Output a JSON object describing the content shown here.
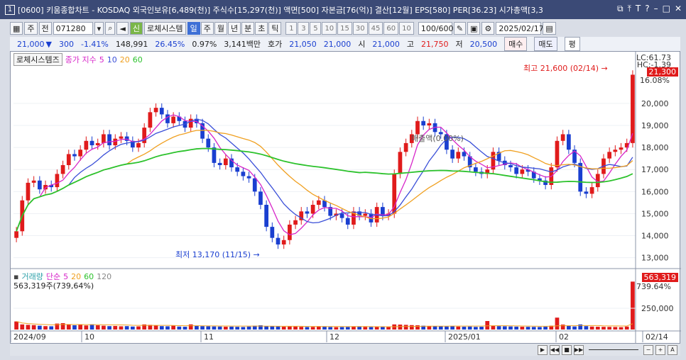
{
  "window": {
    "badge": "1",
    "title": "[0600] 키움종합차트 - KOSDAQ 외국인보유[6,489(천)] 주식수[15,297(천)] 액면[500] 자본금[76(억)] 결산[12월] EPS[580] PER[36.23] 시가총액[3,3"
  },
  "toolbar": {
    "period_type": "주",
    "prev_label": "전",
    "code": "071280",
    "indicator_btn": "로체시스템",
    "tabs": [
      "일",
      "주",
      "월",
      "년",
      "분",
      "초",
      "틱"
    ],
    "active_tab": "일",
    "intervals": [
      "1",
      "3",
      "5",
      "10",
      "15",
      "30",
      "45",
      "60",
      "10"
    ],
    "count": "100/600",
    "date": "2025/02/17"
  },
  "quote": {
    "price": "21,000",
    "arrow": "▼",
    "change": "300",
    "change_pct": "-1.41%",
    "volume": "148,991",
    "ratio": "26.45%",
    "turnover": "0.97%",
    "amount": "3,141백만",
    "bid_label": "호가",
    "bid1": "21,050",
    "bid2": "21,000",
    "open_label": "시",
    "open": "21,000",
    "high_label": "고",
    "high": "21,750",
    "low_label": "저",
    "low": "20,500",
    "buy_label": "매수",
    "sell_label": "매도",
    "eval_label": "평"
  },
  "legend": {
    "stock_name": "로체시스템즈",
    "ma_label": "종가 지수",
    "ma_periods": [
      "5",
      "10",
      "20",
      "60"
    ],
    "ma_colors": [
      "#d726c9",
      "#3a4fd8",
      "#f0a020",
      "#2cc22c"
    ]
  },
  "volume_legend": {
    "label": "거래량",
    "ma_label": "단순",
    "ma_periods": [
      "5",
      "20",
      "60",
      "120"
    ],
    "value_text": "563,319주(739,64%)"
  },
  "annotations": {
    "high": "최고 21,600 (02/14) →",
    "low": "최저 13,170 (11/15) →",
    "overlay": "매출액(0.00%)"
  },
  "price_tags": {
    "lc": "LC:61.73",
    "hc": "HC:-1.39",
    "current": "21,300",
    "pct": "16.08%",
    "vol_current": "563,319",
    "vol_pct": "739.64%"
  },
  "chart_data": {
    "type": "candlestick",
    "price_axis_ticks": [
      "20,000",
      "19,000",
      "18,000",
      "17,000",
      "16,000",
      "15,000",
      "14,000",
      "13,000"
    ],
    "ylim": [
      12700,
      21700
    ],
    "volume_axis_ticks": [
      "250,000"
    ],
    "x_ticks": [
      "2024/09",
      "10",
      "11",
      "12",
      "2025/01",
      "02",
      "02/14"
    ],
    "closes": [
      14200,
      15600,
      16400,
      16500,
      16100,
      16300,
      16200,
      16800,
      17200,
      17700,
      17600,
      17900,
      18300,
      18100,
      18200,
      18600,
      18100,
      18400,
      18500,
      18300,
      18000,
      18200,
      18900,
      19600,
      19800,
      19500,
      19100,
      19400,
      19200,
      18900,
      19300,
      19100,
      18400,
      18000,
      17300,
      17200,
      17500,
      17100,
      16900,
      16700,
      16600,
      16000,
      15400,
      14400,
      13900,
      13600,
      13800,
      14500,
      14700,
      15100,
      15000,
      15400,
      15600,
      15300,
      14900,
      15000,
      14800,
      14500,
      15100,
      14900,
      15000,
      14600,
      15300,
      14900,
      15000,
      16800,
      17800,
      18200,
      18600,
      19200,
      19000,
      19100,
      18700,
      18600,
      17900,
      17500,
      17800,
      17600,
      17100,
      16900,
      16800,
      17000,
      17800,
      17400,
      17200,
      17100,
      16800,
      17000,
      16900,
      16600,
      16500,
      16300,
      17100,
      18300,
      18600,
      17900,
      17300,
      16000,
      15900,
      16200,
      16800,
      17500,
      17800,
      17900,
      18000,
      18200,
      21300
    ],
    "volumes": [
      95000,
      60000,
      55000,
      52000,
      45000,
      40000,
      38000,
      70000,
      75000,
      60000,
      50000,
      55000,
      48000,
      62000,
      50000,
      45000,
      40000,
      42000,
      38000,
      40000,
      35000,
      37000,
      60000,
      55000,
      48000,
      40000,
      38000,
      45000,
      35000,
      33000,
      60000,
      42000,
      40000,
      38000,
      36000,
      35000,
      33000,
      34000,
      32000,
      30000,
      35000,
      45000,
      50000,
      42000,
      40000,
      38000,
      33000,
      36000,
      35000,
      32000,
      30000,
      31000,
      36000,
      34000,
      30000,
      28000,
      29000,
      31000,
      35000,
      33000,
      32000,
      30000,
      36000,
      32000,
      34000,
      60000,
      58000,
      55000,
      52000,
      50000,
      45000,
      42000,
      40000,
      38000,
      36000,
      38000,
      35000,
      33000,
      35000,
      31000,
      33000,
      100000,
      45000,
      40000,
      38000,
      36000,
      34000,
      33000,
      32000,
      31000,
      30000,
      33000,
      45000,
      140000,
      58000,
      42000,
      36000,
      60000,
      40000,
      35000,
      33000,
      32000,
      31000,
      30000,
      28000,
      35000,
      563319
    ]
  }
}
